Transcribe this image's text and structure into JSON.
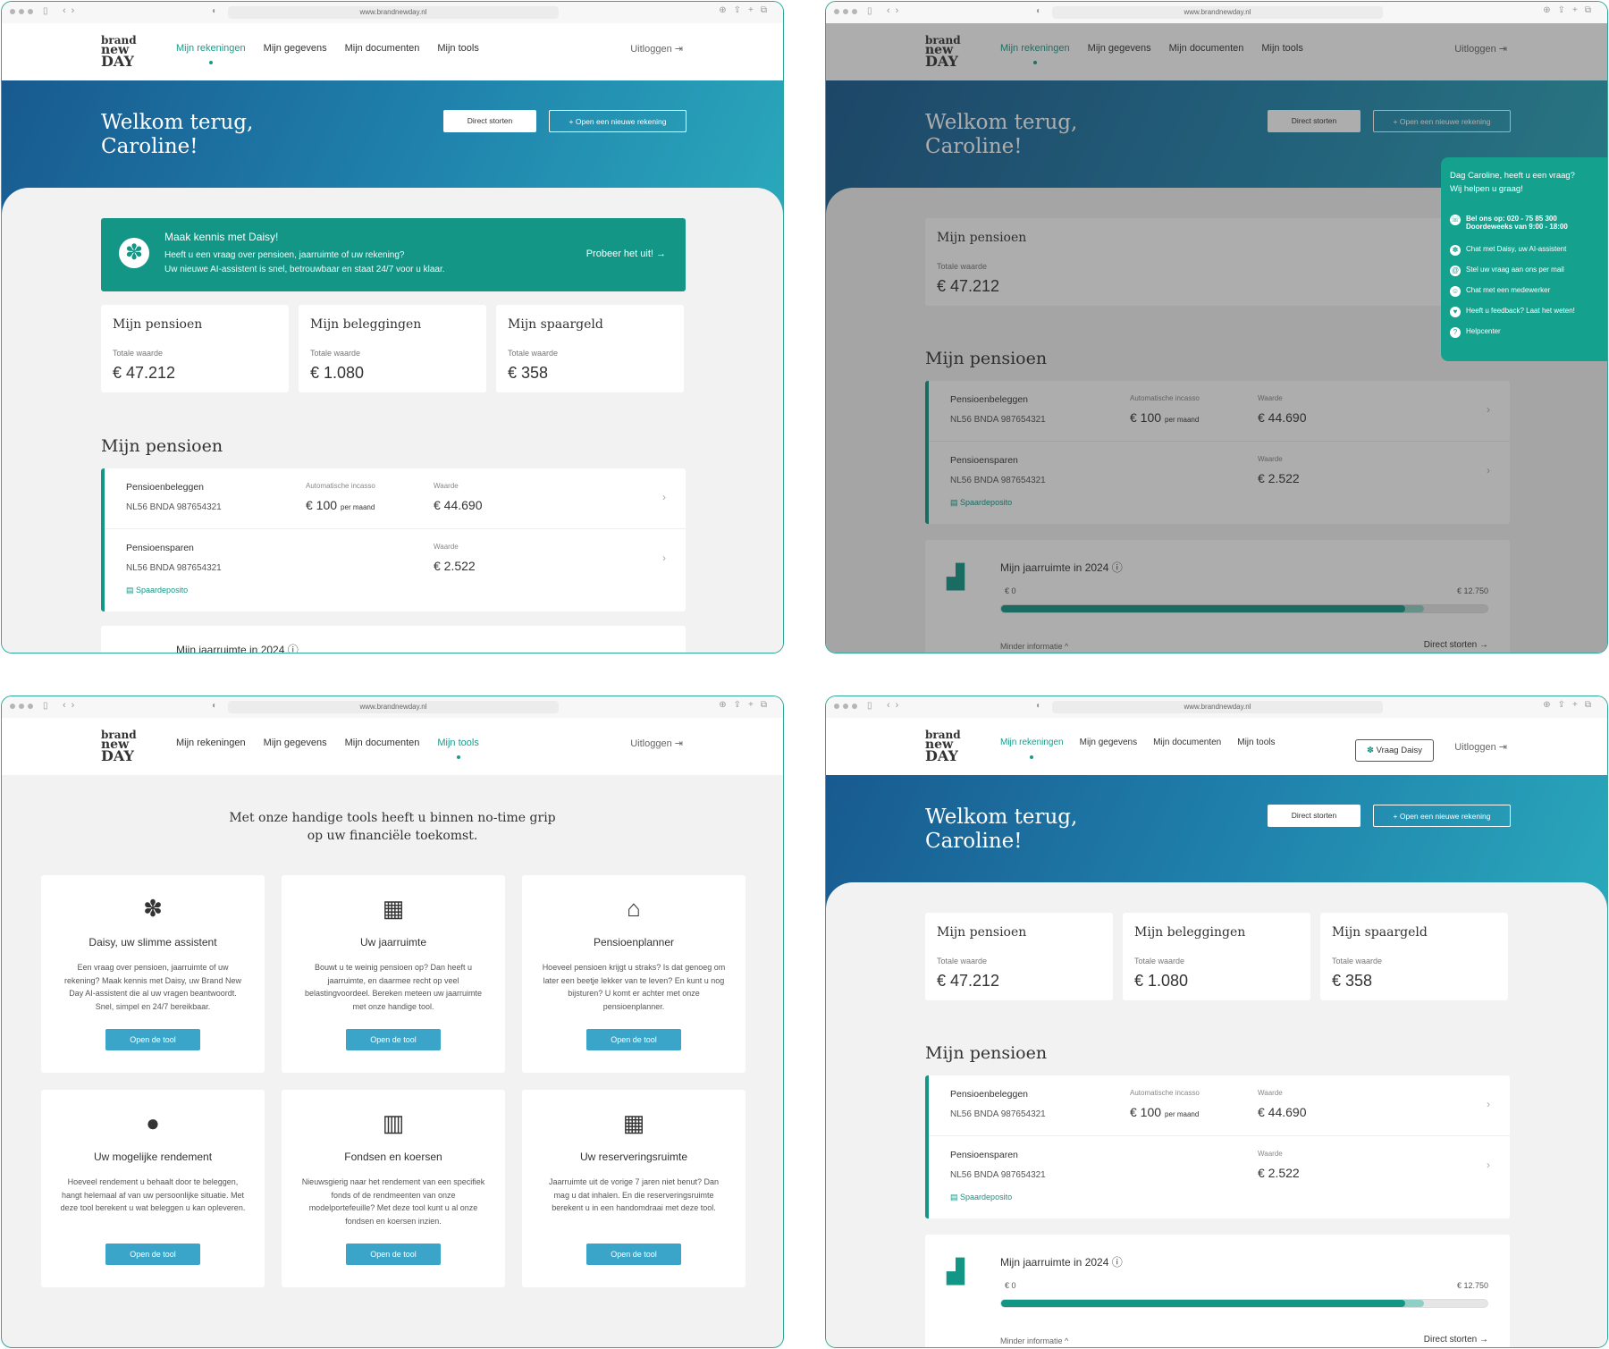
{
  "browser": {
    "url": "www.brandnewday.nl"
  },
  "logo": {
    "line1": "brand",
    "line2": "new",
    "line3": "DAY"
  },
  "nav": {
    "rekeningen": "Mijn rekeningen",
    "gegevens": "Mijn gegevens",
    "documenten": "Mijn documenten",
    "tools": "Mijn tools",
    "logout": "Uitloggen",
    "vraag_daisy": "Vraag Daisy"
  },
  "hero": {
    "line1": "Welkom terug,",
    "line2": "Caroline!",
    "direct_storten": "Direct storten",
    "open_rekening": "+ Open een nieuwe rekening"
  },
  "daisy_banner": {
    "title": "Maak kennis met Daisy!",
    "line1": "Heeft u een vraag over pensioen, jaarruimte of uw rekening?",
    "line2": "Uw nieuwe AI-assistent is snel, betrouwbaar en staat 24/7 voor u klaar.",
    "cta": "Probeer het uit! →"
  },
  "summary": {
    "label": "Totale waarde",
    "pensioen": {
      "title": "Mijn pensioen",
      "value": "€ 47.212"
    },
    "beleggingen": {
      "title": "Mijn beleggingen",
      "value": "€ 1.080"
    },
    "spaargeld": {
      "title": "Mijn spaargeld",
      "value": "€ 358"
    }
  },
  "pensioen": {
    "title": "Mijn pensioen",
    "row1": {
      "name": "Pensioenbeleggen",
      "iban": "NL56 BNDA 987654321",
      "incasso_label": "Automatische incasso",
      "incasso_value": "€ 100",
      "incasso_unit": "per maand",
      "waarde_label": "Waarde",
      "waarde_value": "€ 44.690"
    },
    "row2": {
      "name": "Pensioensparen",
      "iban": "NL56 BNDA 987654321",
      "waarde_label": "Waarde",
      "waarde_value": "€ 2.522",
      "tag": "Spaardeposito"
    }
  },
  "jaarruimte": {
    "title": "Mijn jaarruimte in 2024 ⓘ",
    "min": "€ 0",
    "max": "€ 12.750",
    "progress": 0.83,
    "link": "Minder informatie ^",
    "storten": "Direct storten →"
  },
  "chat": {
    "header1": "Dag Caroline, heeft u een vraag?",
    "header2": "Wij helpen u graag!",
    "phone_label": "Bel ons op: 020 - 75 85 300",
    "phone_hours": "Doordeweeks van 9:00 - 18:00",
    "item2": "Chat met Daisy, uw AI-assistent",
    "item3": "Stel uw vraag aan ons per mail",
    "item4": "Chat met een medewerker",
    "item5": "Heeft u feedback? Laat het weten!",
    "item6": "Helpcenter"
  },
  "tools": {
    "intro1": "Met onze handige tools heeft u binnen no-time grip",
    "intro2": "op uw financiële toekomst.",
    "button": "Open de tool",
    "items": [
      {
        "title": "Daisy, uw slimme assistent",
        "desc": "Een vraag over pensioen, jaarruimte of uw rekening? Maak kennis met Daisy, uw Brand New Day AI-assistent die al uw vragen beantwoordt. Snel, simpel en 24/7 bereikbaar.",
        "icon": "flower-icon"
      },
      {
        "title": "Uw jaarruimte",
        "desc": "Bouwt u te weinig pensioen op? Dan heeft u jaarruimte, en daarmee recht op veel belastingvoordeel. Bereken meteen uw jaarruimte met onze handige tool.",
        "icon": "calculator-icon"
      },
      {
        "title": "Pensioenplanner",
        "desc": "Hoeveel pensioen krijgt u straks? Is dat genoeg om later een beetje lekker van te leven? En kunt u nog bijsturen? U komt er achter met onze pensioenplanner.",
        "icon": "bank-icon"
      },
      {
        "title": "Uw mogelijke rendement",
        "desc": "Hoeveel rendement u behaalt door te beleggen, hangt helemaal af van uw persoonlijke situatie. Met deze tool berekent u wat beleggen u kan opleveren.",
        "icon": "piggy-bank-icon"
      },
      {
        "title": "Fondsen en koersen",
        "desc": "Nieuwsgierig naar het rendement van een specifiek fonds of de rendmeenten van onze modelportefeuille? Met deze tool kunt u al onze fondsen en koersen inzien.",
        "icon": "chart-icon"
      },
      {
        "title": "Uw reserveringsruimte",
        "desc": "Jaarruimte uit de vorige 7 jaren niet benut? Dan mag u dat inhalen. En die reserveringsruimte berekent u in een handomdraai met deze tool.",
        "icon": "calculator-clock-icon"
      }
    ]
  }
}
